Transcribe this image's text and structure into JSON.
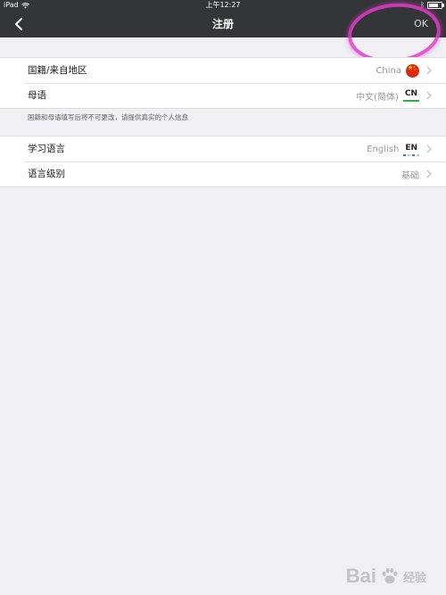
{
  "statusbar": {
    "device": "iPad",
    "time": "上午12:27"
  },
  "navbar": {
    "title": "注册",
    "ok_label": "OK"
  },
  "profile": {
    "rows": [
      {
        "label": "国籍/来自地区",
        "value": "China",
        "icon": "china-flag-icon"
      },
      {
        "label": "母语",
        "value": "中文(简体)",
        "tag": "CN"
      }
    ],
    "note": "国籍和母语填写后将不可更改，请提供真实的个人信息"
  },
  "learning": {
    "rows": [
      {
        "label": "学习语言",
        "value": "English",
        "tag": "EN"
      },
      {
        "label": "语言级别",
        "value": "基础"
      }
    ]
  },
  "watermark": {
    "text_left": "Bai",
    "text_right": "经验"
  },
  "colors": {
    "header_bg": "#333537",
    "page_bg": "#efeff4",
    "highlight": "#e13cc8",
    "cn_underline": "#2bb24c",
    "flag_red": "#de2910"
  }
}
